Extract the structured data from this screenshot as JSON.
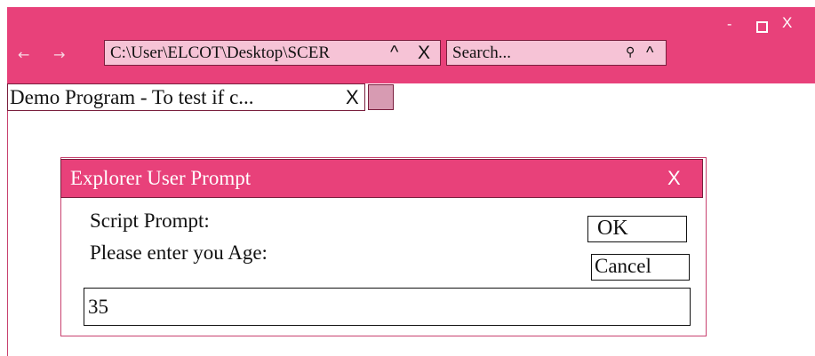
{
  "window": {
    "controls": {
      "minimize": "-",
      "close": "X"
    }
  },
  "nav": {
    "back": "←",
    "forward": "→"
  },
  "address_bar": {
    "value": "C:\\User\\ELCOT\\Desktop\\SCER",
    "caret": "^",
    "clear": "X"
  },
  "search": {
    "placeholder": "Search...",
    "icon": "⚲",
    "caret": "^"
  },
  "tab": {
    "label": "Demo Program - To test if c...",
    "close": "X"
  },
  "dialog": {
    "title": "Explorer User Prompt",
    "close": "X",
    "prompt_line1": "Script Prompt:",
    "prompt_line2": "Please enter you Age:",
    "ok_label": "OK",
    "cancel_label": "Cancel",
    "input_value": "35"
  },
  "colors": {
    "accent": "#e8417a",
    "field": "#f6c3d6",
    "new_tab": "#d79bb2"
  }
}
